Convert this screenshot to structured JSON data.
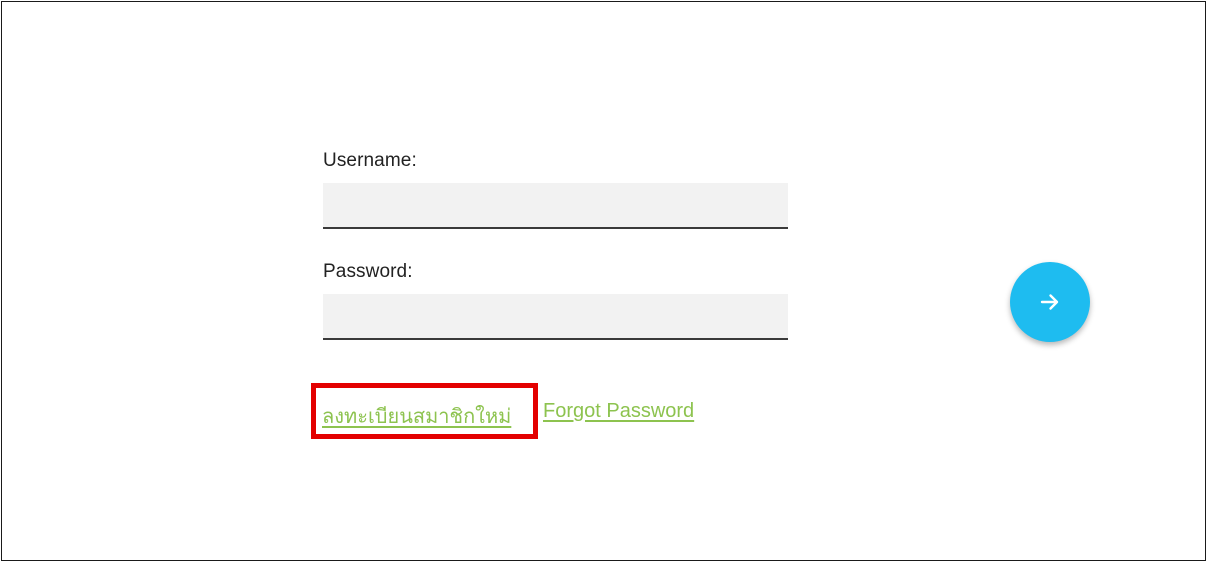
{
  "form": {
    "username_label": "Username:",
    "username_value": "",
    "password_label": "Password:",
    "password_value": "",
    "submit_icon": "arrow-right-icon"
  },
  "links": {
    "register_label": "ลงทะเบียนสมาชิกใหม่",
    "forgot_password_label": "Forgot Password"
  },
  "colors": {
    "submit_button": "#1ebcf0",
    "link": "#8dc34f",
    "highlight_box": "#e30000",
    "input_background": "#f2f2f2"
  }
}
